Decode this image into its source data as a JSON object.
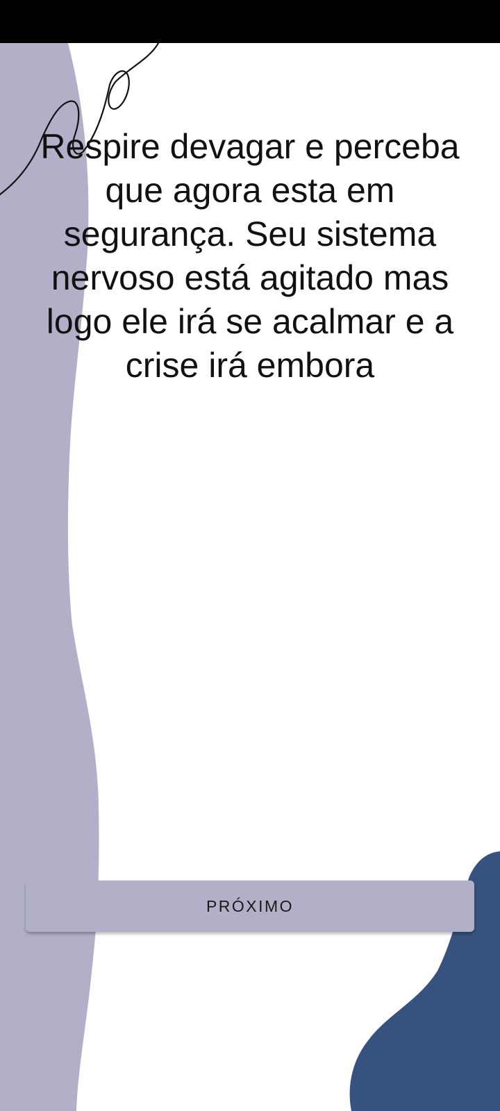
{
  "screen": {
    "message": "Respire devagar e perceba que agora esta em segurança. Seu sistema nervoso está agitado mas logo ele irá se acalmar e a crise irá embora",
    "next_label": "PRÓXIMO"
  },
  "colors": {
    "lavender_shape": "#b1b0c8",
    "navy_shape": "#37527e",
    "button_bg": "#b1b0c8",
    "status_bar": "#000000",
    "text": "#111111"
  },
  "icons": {
    "decorative_line": "squiggle-line-icon"
  }
}
